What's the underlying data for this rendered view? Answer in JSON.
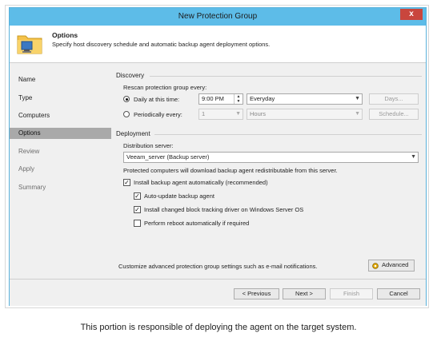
{
  "window": {
    "title": "New Protection Group",
    "close_label": "x"
  },
  "header": {
    "title": "Options",
    "description": "Specify host discovery schedule and automatic backup agent deployment options.",
    "icon": "folder-computer-icon"
  },
  "nav": {
    "items": [
      {
        "label": "Name"
      },
      {
        "label": "Type"
      },
      {
        "label": "Computers"
      },
      {
        "label": "Options"
      },
      {
        "label": "Review"
      },
      {
        "label": "Apply"
      },
      {
        "label": "Summary"
      }
    ],
    "active": "Options"
  },
  "discovery": {
    "section_label": "Discovery",
    "rescan_label": "Rescan protection group every:",
    "daily": {
      "label": "Daily at this time:",
      "selected": true,
      "time": "9:00 PM",
      "frequency": "Everyday",
      "button": "Days..."
    },
    "periodic": {
      "label": "Periodically every:",
      "selected": false,
      "value": "1",
      "unit": "Hours",
      "button": "Schedule..."
    }
  },
  "deployment": {
    "section_label": "Deployment",
    "distribution_label": "Distribution server:",
    "distribution_value": "Veeam_server (Backup server)",
    "distribution_note": "Protected computers will download backup agent redistributable from this server.",
    "install_auto": {
      "label": "Install backup agent automatically (recommended)",
      "checked": true
    },
    "auto_update": {
      "label": "Auto-update backup agent",
      "checked": true
    },
    "cbt_driver": {
      "label": "Install changed block tracking driver on Windows Server OS",
      "checked": true
    },
    "reboot": {
      "label": "Perform reboot automatically if required",
      "checked": false
    }
  },
  "advanced": {
    "text": "Customize advanced protection group settings such as e-mail notifications.",
    "button": "Advanced",
    "icon": "gear-icon"
  },
  "footer": {
    "previous": "< Previous",
    "next": "Next >",
    "finish": "Finish",
    "cancel": "Cancel"
  },
  "caption": "This portion is responsible of deploying the agent on the target system."
}
